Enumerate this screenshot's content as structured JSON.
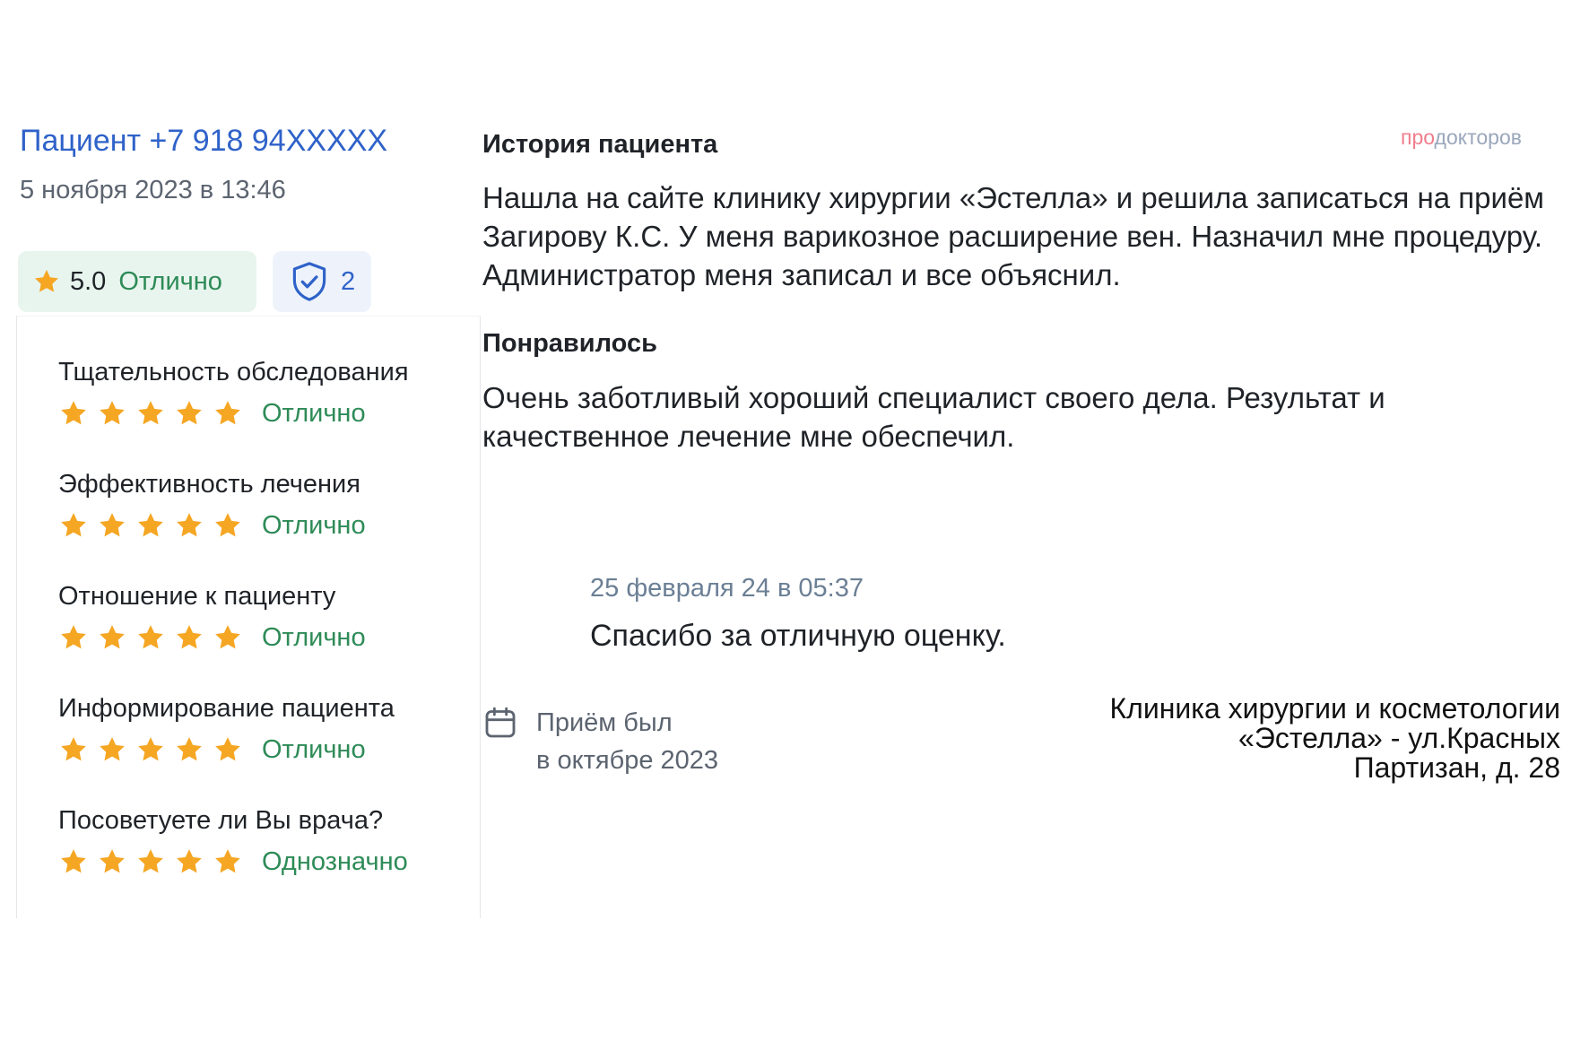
{
  "review": {
    "author": "Пациент +7 918 94XXXXX",
    "date": "5 ноября 2023 в 13:46",
    "overall_rating": "5.0",
    "overall_word": "Отлично",
    "verify_count": "2",
    "brand_part1": "про",
    "brand_part2": "докторов"
  },
  "criteria": [
    {
      "label": "Тщательность обследования",
      "stars": 5,
      "word": "Отлично"
    },
    {
      "label": "Эффективность лечения",
      "stars": 5,
      "word": "Отлично"
    },
    {
      "label": "Отношение к пациенту",
      "stars": 5,
      "word": "Отлично"
    },
    {
      "label": "Информирование пациента",
      "stars": 5,
      "word": "Отлично"
    },
    {
      "label": "Посоветуете ли Вы врача?",
      "stars": 5,
      "word": "Однозначно"
    }
  ],
  "sections": {
    "history_title": "История пациента",
    "history_text": "Нашла на сайте клинику хирургии «Эстелла» и решила записаться на приём Загирову К.С. У меня варикозное расширение вен. Назначил мне процедуру. Администратор меня записал и все объяснил.",
    "liked_title": "Понравилось",
    "liked_text": "Очень заботливый хороший специалист своего дела. Результат и качественное лечение мне обеспечил."
  },
  "reply": {
    "date": "25 февраля 24 в 05:37",
    "text": "Спасибо за отличную оценку."
  },
  "visit": {
    "line1": "Приём был",
    "line2": "в октябре 2023"
  },
  "clinic": {
    "line1": "Клиника хирургии и косметологии",
    "line2": "«Эстелла» - ул.Красных",
    "line3": "Партизан, д. 28"
  },
  "colors": {
    "star": "#f5a623",
    "link": "#2f62c9",
    "positive": "#2e8b57"
  },
  "icons": {
    "rating": "star-icon",
    "verify": "shield-check-icon",
    "visit": "calendar-icon"
  }
}
